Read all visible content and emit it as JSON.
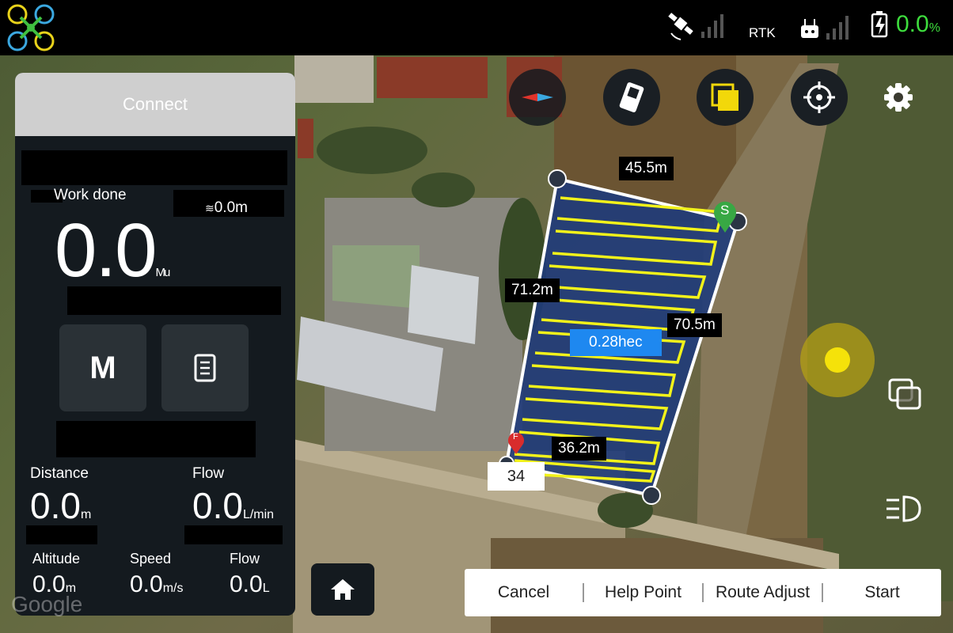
{
  "topbar": {
    "rtk_label": "RTK",
    "battery_value": "0.0",
    "battery_unit": "%",
    "battery_color": "#3ddc3d"
  },
  "panel": {
    "connect_label": "Connect",
    "work_done_label": "Work done",
    "height_value": "0.0m",
    "work_done_value": "0.0",
    "work_done_unit": "Mu",
    "mode_button_label": "M",
    "distance_label": "Distance",
    "distance_value": "0.0",
    "distance_unit": "m",
    "flow_label": "Flow",
    "flow_value": "0.0",
    "flow_unit": "L/min",
    "altitude_label": "Altitude",
    "altitude_value": "0.0",
    "altitude_unit": "m",
    "speed_label": "Speed",
    "speed_value": "0.0",
    "speed_unit": "m/s",
    "flow2_label": "Flow",
    "flow2_value": "0.0",
    "flow2_unit": "L"
  },
  "map": {
    "edge_top": "45.5m",
    "edge_left": "71.2m",
    "edge_right": "70.5m",
    "edge_bottom": "36.2m",
    "area": "0.28hec",
    "point_count": "34",
    "start_marker": "S",
    "finish_marker": "F",
    "watermark": "Google"
  },
  "actions": {
    "cancel": "Cancel",
    "help_point": "Help Point",
    "route_adjust": "Route Adjust",
    "start": "Start"
  },
  "icons": [
    "compass-icon",
    "remote-icon",
    "layers-icon",
    "locate-icon",
    "gear-icon",
    "home-icon",
    "satellite-icon",
    "battery-icon",
    "light-icon",
    "copy-icon"
  ],
  "colors": {
    "route": "#f2f21a",
    "field_fill": "#1f3b7a",
    "accent": "#1e88f0",
    "panel": "#141a1f"
  }
}
